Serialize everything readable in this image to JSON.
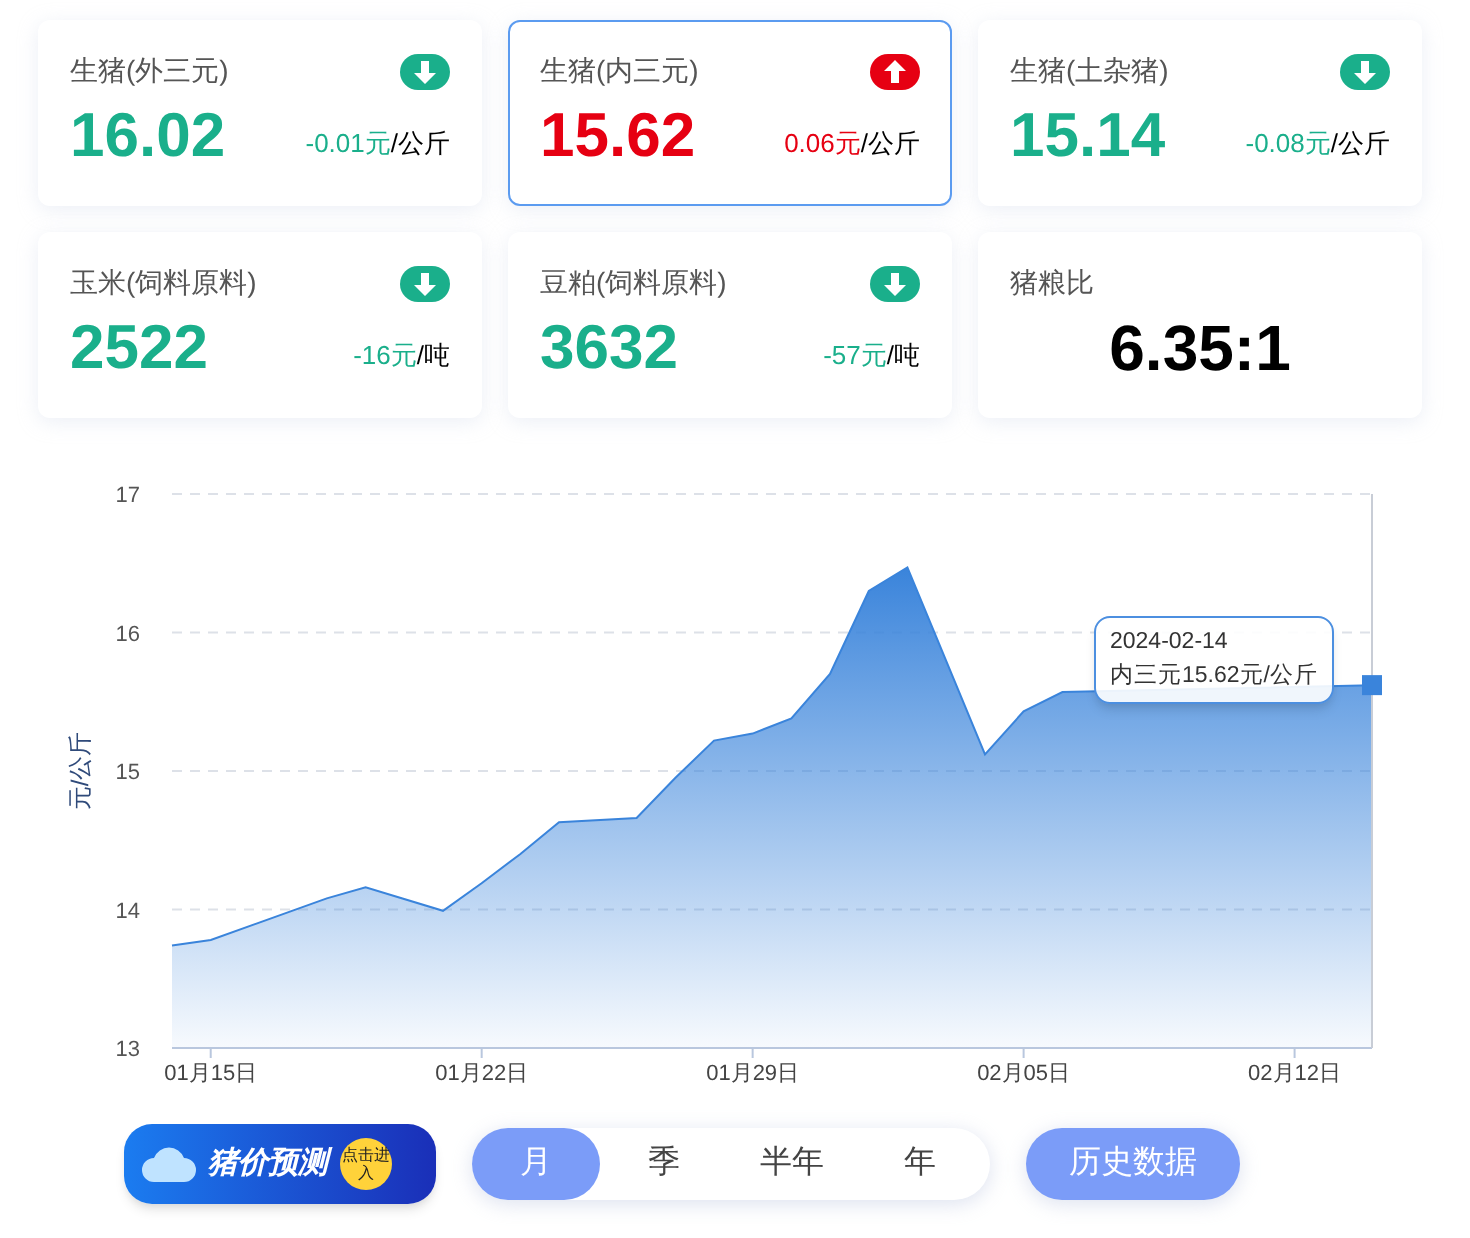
{
  "cards": [
    {
      "kind": "price",
      "title": "生猪(外三元)",
      "rising": false,
      "selected": false,
      "value": "16.02",
      "change": "-0.01元",
      "unit": "/公斤"
    },
    {
      "kind": "price",
      "title": "生猪(内三元)",
      "rising": true,
      "selected": true,
      "value": "15.62",
      "change": "0.06元",
      "unit": "/公斤"
    },
    {
      "kind": "price",
      "title": "生猪(土杂猪)",
      "rising": false,
      "selected": false,
      "value": "15.14",
      "change": "-0.08元",
      "unit": "/公斤"
    },
    {
      "kind": "price",
      "title": "玉米(饲料原料)",
      "rising": false,
      "selected": false,
      "value": "2522",
      "change": "-16元",
      "unit": "/吨"
    },
    {
      "kind": "price",
      "title": "豆粕(饲料原料)",
      "rising": false,
      "selected": false,
      "value": "3632",
      "change": "-57元",
      "unit": "/吨"
    },
    {
      "kind": "ratio",
      "title": "猪粮比",
      "selected": false,
      "value": "6.35:1"
    }
  ],
  "chart": {
    "chart_data": {
      "type": "area",
      "ylabel": "元/公斤",
      "grid": true,
      "x": [
        "2024-01-14",
        "2024-01-15",
        "2024-01-18",
        "2024-01-19",
        "2024-01-21",
        "2024-01-22",
        "2024-01-23",
        "2024-01-24",
        "2024-01-26",
        "2024-01-27",
        "2024-01-28",
        "2024-01-29",
        "2024-01-30",
        "2024-01-31",
        "2024-02-01",
        "2024-02-02",
        "2024-02-04",
        "2024-02-05",
        "2024-02-06",
        "2024-02-14"
      ],
      "series": [
        {
          "name": "内三元",
          "color": "#3a84db",
          "values": [
            13.74,
            13.78,
            14.08,
            14.16,
            13.99,
            14.19,
            14.4,
            14.63,
            14.66,
            14.95,
            15.22,
            15.27,
            15.38,
            15.7,
            16.3,
            16.47,
            15.12,
            15.43,
            15.57,
            15.62
          ]
        }
      ],
      "xlim": [
        "2024-01-14",
        "2024-02-14"
      ],
      "ylim": [
        13,
        17
      ],
      "xticks": [
        {
          "value": "2024-01-15",
          "label": "01月15日"
        },
        {
          "value": "2024-01-22",
          "label": "01月22日"
        },
        {
          "value": "2024-01-29",
          "label": "01月29日"
        },
        {
          "value": "2024-02-05",
          "label": "02月05日"
        },
        {
          "value": "2024-02-12",
          "label": "02月12日"
        }
      ],
      "yticks": [
        13,
        14,
        15,
        16,
        17
      ]
    },
    "tooltip": {
      "date": "2024-02-14",
      "value": "15.62元/公斤"
    }
  },
  "banner": {
    "title": "猪价预测",
    "badge": "点击进入"
  },
  "periods": [
    {
      "label": "月",
      "selected": true
    },
    {
      "label": "季",
      "selected": false
    },
    {
      "label": "半年",
      "selected": false
    },
    {
      "label": "年",
      "selected": false
    }
  ],
  "history_button": "历史数据"
}
